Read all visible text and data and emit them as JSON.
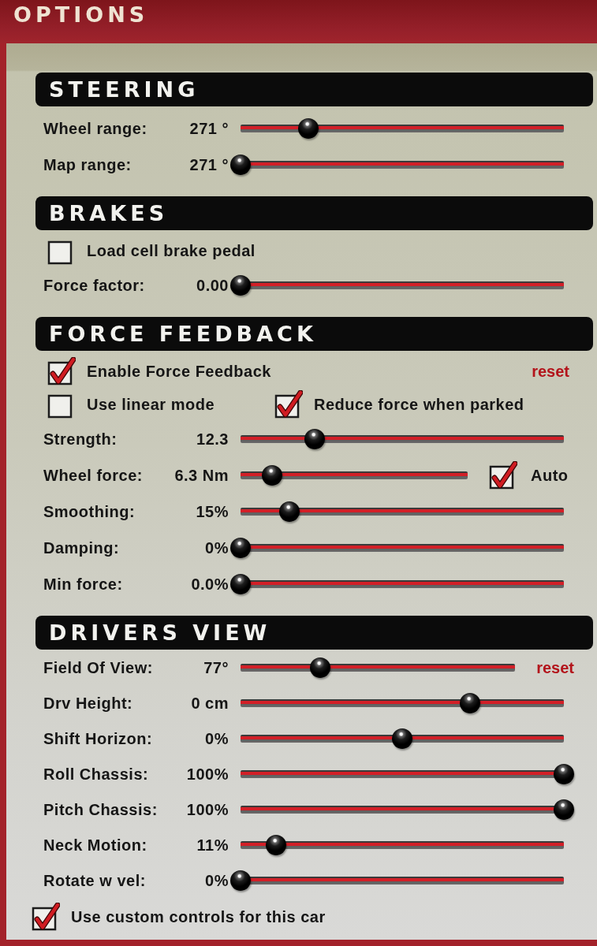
{
  "window": {
    "title": "OPTIONS"
  },
  "sections": [
    {
      "title": "STEERING",
      "rows": [
        {
          "kind": "slider",
          "label": "Wheel range:",
          "value": "271 °",
          "level": 0.21
        },
        {
          "kind": "slider",
          "label": "Map range:",
          "value": "271 °",
          "level": 0
        }
      ]
    },
    {
      "title": "BRAKES",
      "rows": [
        {
          "kind": "checks",
          "items": [
            {
              "label": "Load cell brake pedal",
              "checked": false
            }
          ]
        },
        {
          "kind": "slider",
          "label": "Force factor:",
          "value": "0.00",
          "level": 0
        }
      ]
    },
    {
      "title": "FORCE FEEDBACK",
      "rows": [
        {
          "kind": "checks",
          "items": [
            {
              "label": "Enable Force Feedback",
              "checked": true
            }
          ],
          "link": "reset"
        },
        {
          "kind": "checks",
          "items": [
            {
              "label": "Use linear mode",
              "checked": false
            },
            {
              "label": "Reduce force when parked",
              "checked": true
            }
          ]
        },
        {
          "kind": "slider",
          "label": "Strength:",
          "value": "12.3",
          "level": 0.23
        },
        {
          "kind": "slider",
          "label": "Wheel force:",
          "value": "6.3 Nm",
          "level": 0.14,
          "option": {
            "label": "Auto",
            "checked": true
          }
        },
        {
          "kind": "slider",
          "label": "Smoothing:",
          "value": "15%",
          "level": 0.15
        },
        {
          "kind": "slider",
          "label": "Damping:",
          "value": "0%",
          "level": 0
        },
        {
          "kind": "slider",
          "label": "Min force:",
          "value": "0.0%",
          "level": 0
        }
      ]
    },
    {
      "title": "DRIVERS VIEW",
      "rows": [
        {
          "kind": "slider",
          "label": "Field Of View:",
          "value": "77°",
          "level": 0.29,
          "link": "reset"
        },
        {
          "kind": "slider",
          "label": "Drv Height:",
          "value": "0 cm",
          "level": 0.71
        },
        {
          "kind": "slider",
          "label": "Shift Horizon:",
          "value": "0%",
          "level": 0.5
        },
        {
          "kind": "slider",
          "label": "Roll Chassis:",
          "value": "100%",
          "level": 1
        },
        {
          "kind": "slider",
          "label": "Pitch Chassis:",
          "value": "100%",
          "level": 1
        },
        {
          "kind": "slider",
          "label": "Neck Motion:",
          "value": "11%",
          "level": 0.11
        },
        {
          "kind": "slider",
          "label": "Rotate w vel:",
          "value": "0%",
          "level": 0
        }
      ]
    }
  ],
  "footer_checkbox": {
    "label": "Use custom controls for this car",
    "checked": true
  }
}
